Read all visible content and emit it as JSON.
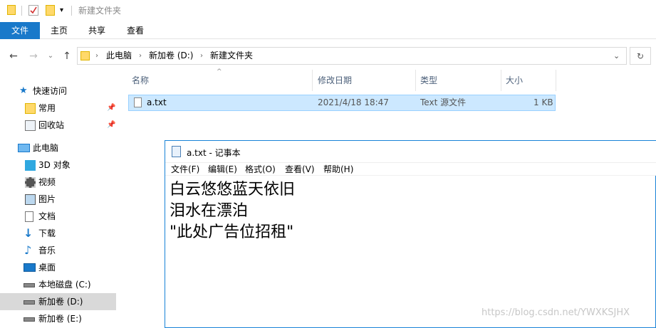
{
  "window": {
    "title": "新建文件夹"
  },
  "ribbon": {
    "tabs": [
      "文件",
      "主页",
      "共享",
      "查看"
    ]
  },
  "address": {
    "crumbs": [
      "此电脑",
      "新加卷 (D:)",
      "新建文件夹"
    ]
  },
  "sidebar": {
    "quick_access": "快速访问",
    "items": [
      {
        "label": "常用",
        "icon": "folder-icon",
        "pinned": true
      },
      {
        "label": "回收站",
        "icon": "recycle-bin-icon",
        "pinned": true
      }
    ],
    "this_pc": "此电脑",
    "pc_items": [
      {
        "label": "3D 对象",
        "icon": "3d-objects-icon"
      },
      {
        "label": "视频",
        "icon": "video-icon"
      },
      {
        "label": "图片",
        "icon": "pictures-icon"
      },
      {
        "label": "文档",
        "icon": "documents-icon"
      },
      {
        "label": "下载",
        "icon": "download-icon"
      },
      {
        "label": "音乐",
        "icon": "music-icon"
      },
      {
        "label": "桌面",
        "icon": "desktop-icon"
      },
      {
        "label": "本地磁盘 (C:)",
        "icon": "drive-icon"
      },
      {
        "label": "新加卷 (D:)",
        "icon": "drive-icon",
        "selected": true
      },
      {
        "label": "新加卷 (E:)",
        "icon": "drive-icon"
      }
    ]
  },
  "file_list": {
    "columns": [
      "名称",
      "修改日期",
      "类型",
      "大小"
    ],
    "rows": [
      {
        "name": "a.txt",
        "date": "2021/4/18 18:47",
        "type": "Text 源文件",
        "size": "1 KB"
      }
    ]
  },
  "notepad": {
    "title": "a.txt - 记事本",
    "menu": [
      "文件(F)",
      "编辑(E)",
      "格式(O)",
      "查看(V)",
      "帮助(H)"
    ],
    "lines": [
      "白云悠悠蓝天依旧",
      "泪水在漂泊",
      "\"此处广告位招租\""
    ]
  },
  "watermark": "https://blog.csdn.net/YWXKSJHX",
  "colors": {
    "accent": "#1979ca",
    "selection": "#cce8ff",
    "folder": "#ffd96b"
  }
}
